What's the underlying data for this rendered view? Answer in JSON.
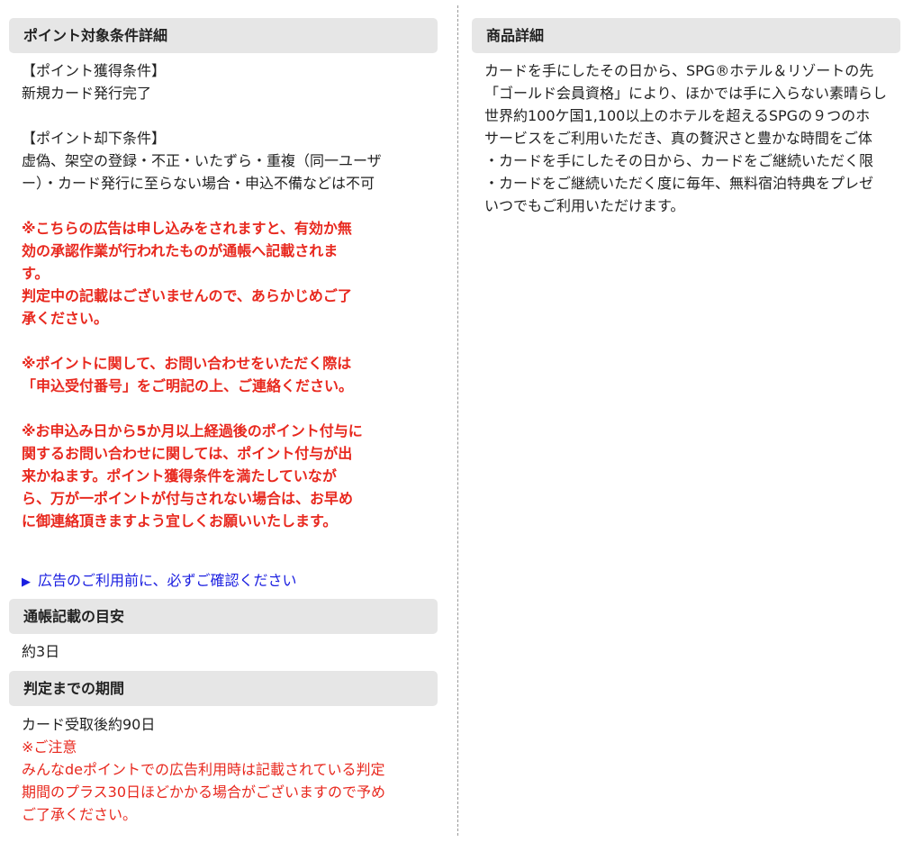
{
  "left": {
    "point_conditions": {
      "header": "ポイント対象条件詳細",
      "earn_title": "【ポイント獲得条件】",
      "earn_text": "新規カード発行完了",
      "reject_title": "【ポイント却下条件】",
      "reject_lines": [
        "虚偽、架空の登録・不正・いたずら・重複（同一ユーザ",
        "ー）・カード発行に至らない場合・申込不備などは不可"
      ],
      "notice1_lines": [
        "※こちらの広告は申し込みをされますと、有効か無",
        "効の承認作業が行われたものが通帳へ記載されま",
        "す。",
        "判定中の記載はございませんので、あらかじめご了",
        "承ください。"
      ],
      "notice2_lines": [
        "※ポイントに関して、お問い合わせをいただく際は",
        "「申込受付番号」をご明記の上、ご連絡ください。"
      ],
      "notice3_lines": [
        "※お申込み日から5か月以上経過後のポイント付与に",
        "関するお問い合わせに関しては、ポイント付与が出",
        "来かねます。ポイント獲得条件を満たしていなが",
        "ら、万が一ポイントが付与されない場合は、お早め",
        "に御連絡頂きますよう宜しくお願いいたします。"
      ],
      "link_icon": "▶",
      "link_text": "広告のご利用前に、必ずご確認ください"
    },
    "passbook": {
      "header": "通帳記載の目安",
      "value": "約3日"
    },
    "judgement": {
      "header": "判定までの期間",
      "value": "カード受取後約90日",
      "note_title": "※ご注意",
      "note_lines": [
        "みんなdeポイントでの広告利用時は記載されている判定",
        "期間のプラス30日ほどかかる場合がございますので予め",
        "ご了承ください。"
      ]
    }
  },
  "right": {
    "product": {
      "header": "商品詳細",
      "lines": [
        "カードを手にしたその日から、SPG®ホテル＆リゾートの先",
        "「ゴールド会員資格」により、ほかでは手に入らない素晴らし",
        "世界約100ケ国1,100以上のホテルを超えるSPGの９つのホ",
        "サービスをご利用いただき、真の贅沢さと豊かな時間をご体",
        "・カードを手にしたその日から、カードをご継続いただく限",
        "・カードをご継続いただく度に毎年、無料宿泊特典をプレゼ",
        "いつでもご利用いただけます。"
      ]
    }
  },
  "colors": {
    "header_bg": "#e6e6e6",
    "notice_red": "#e8281e",
    "link_blue": "#1a1ee0"
  }
}
